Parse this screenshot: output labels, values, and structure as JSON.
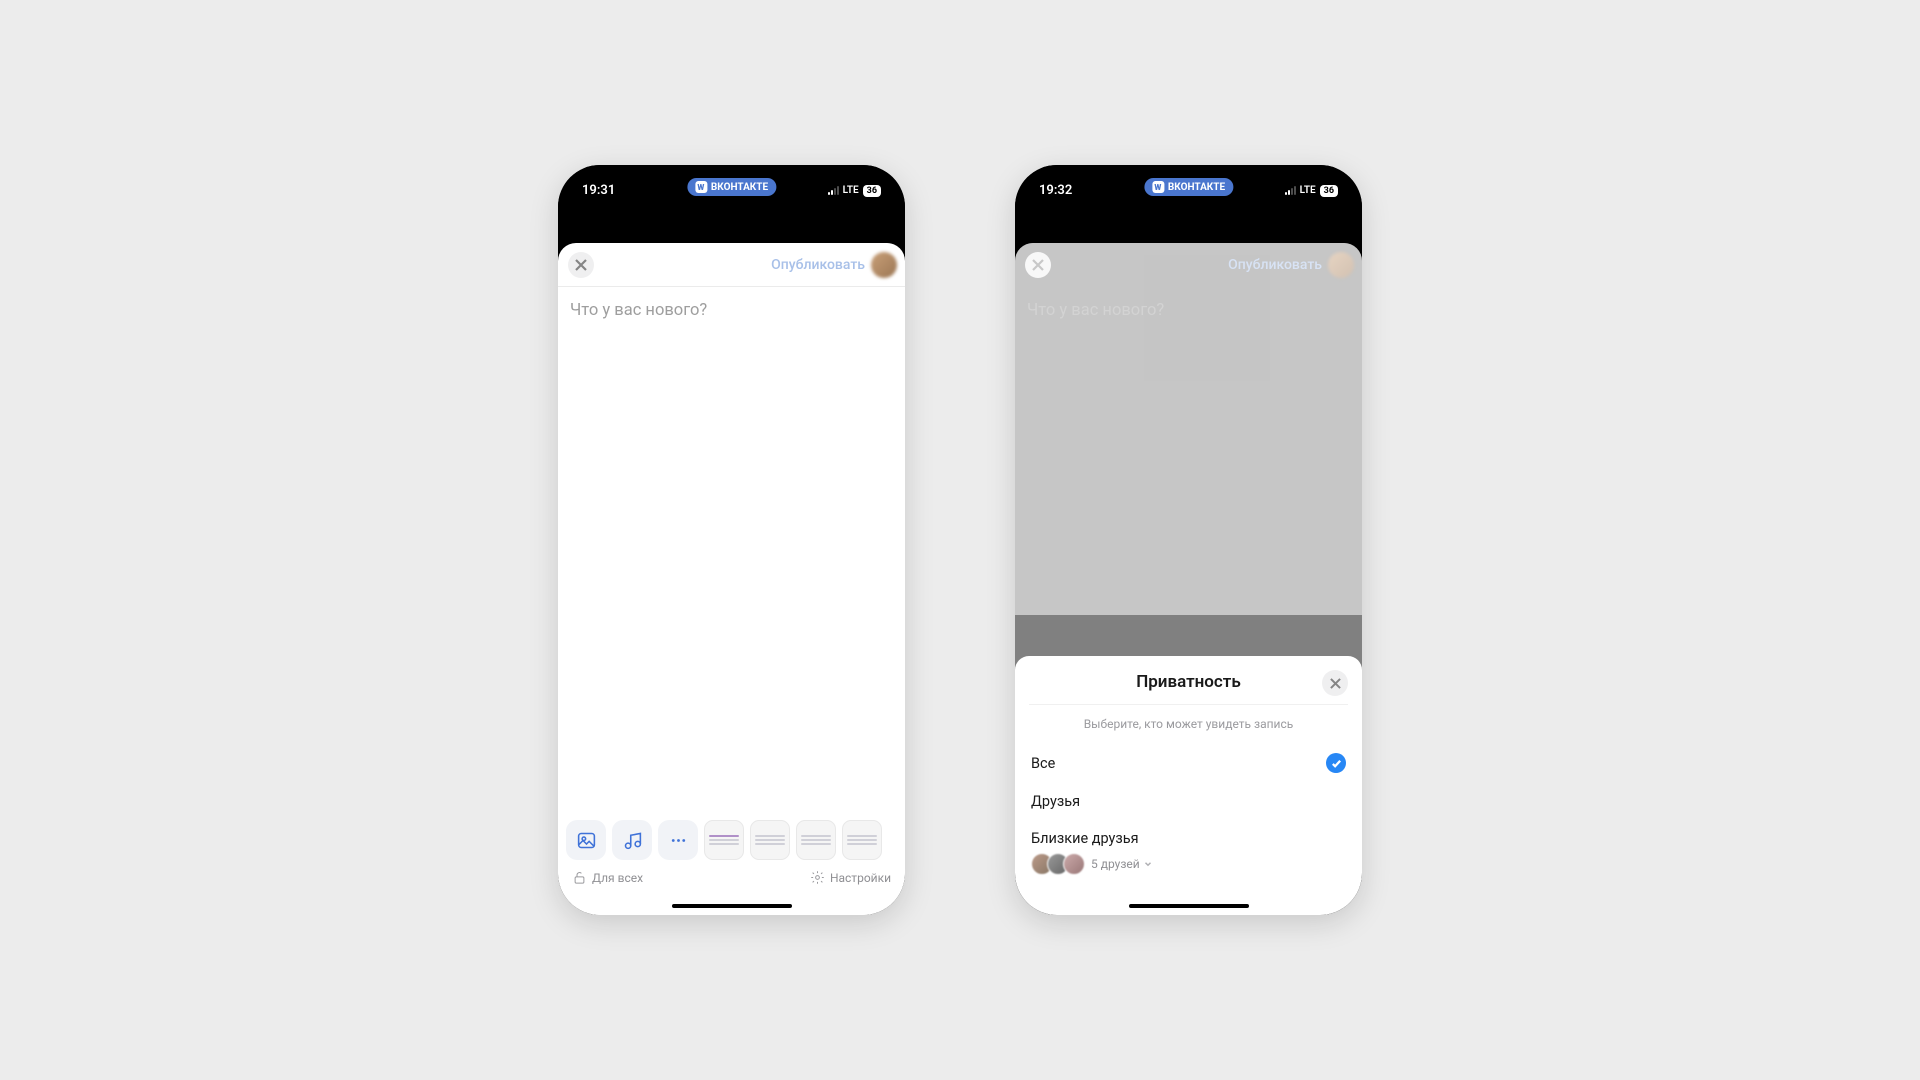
{
  "left": {
    "status": {
      "time": "19:31",
      "app_pill": "ВКОНТАКТЕ",
      "network": "LTE",
      "battery": "36"
    },
    "header": {
      "publish": "Опубликовать"
    },
    "body": {
      "placeholder": "Что у вас нового?"
    },
    "footer": {
      "visibility": "Для всех",
      "settings": "Настройки"
    }
  },
  "right": {
    "status": {
      "time": "19:32",
      "app_pill": "ВКОНТАКТЕ",
      "network": "LTE",
      "battery": "36"
    },
    "header": {
      "publish": "Опубликовать"
    },
    "body": {
      "placeholder": "Что у вас нового?"
    },
    "sheet": {
      "title": "Приватность",
      "subtitle": "Выберите, кто может увидеть запись",
      "options": {
        "all": "Все",
        "friends": "Друзья",
        "close": "Близкие друзья"
      },
      "friends_count": "5 друзей"
    }
  }
}
